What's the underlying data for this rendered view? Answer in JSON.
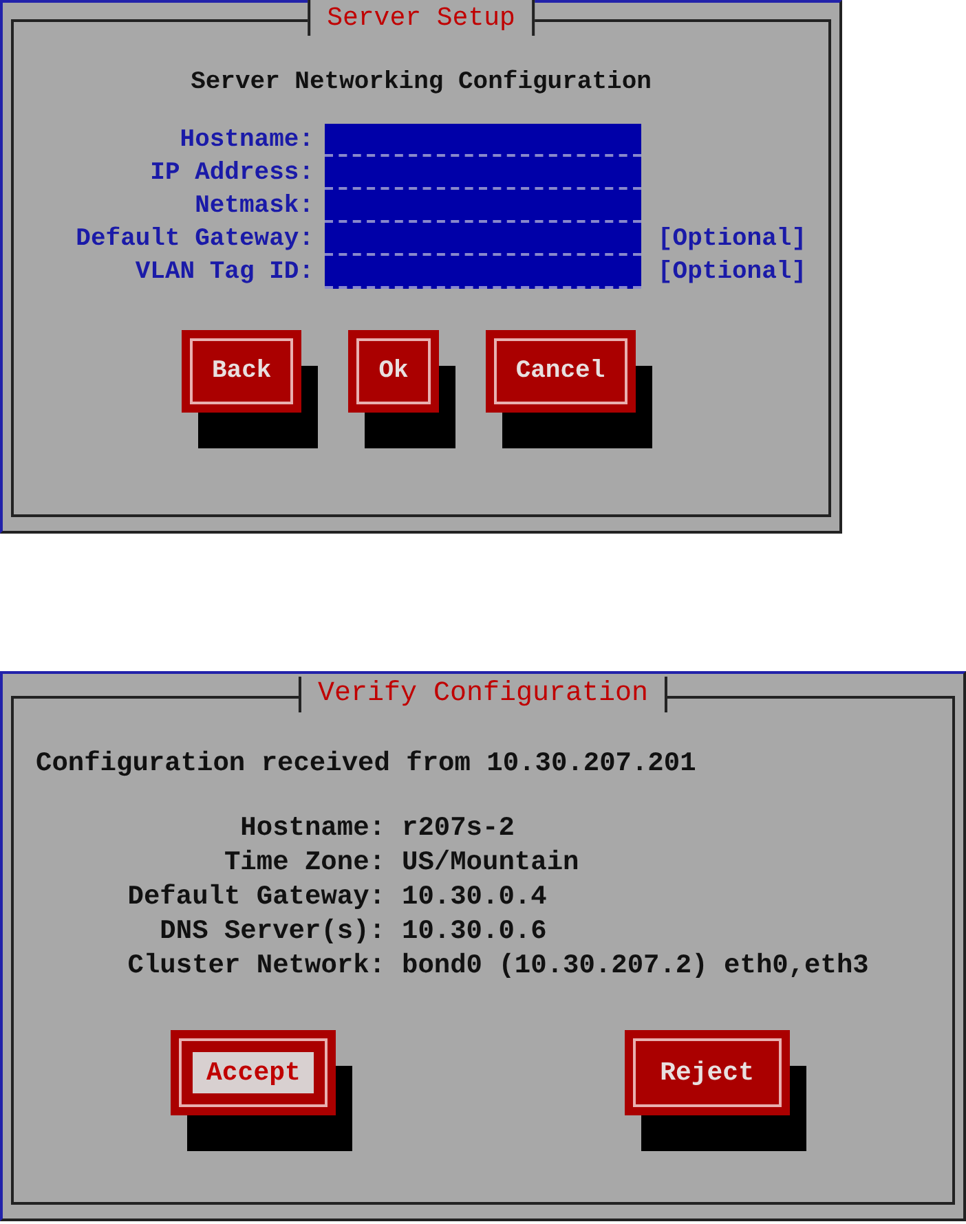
{
  "dialogs": [
    {
      "title": "Server Setup",
      "heading": "Server Networking Configuration",
      "kind": "form",
      "fields": [
        {
          "label": "Hostname:"
        },
        {
          "label": "IP Address:"
        },
        {
          "label": "Netmask:"
        },
        {
          "label": "Default Gateway:",
          "hint": "[Optional]"
        },
        {
          "label": "VLAN Tag ID:",
          "hint": "[Optional]"
        }
      ],
      "buttons": [
        {
          "label": "Back",
          "focused": false
        },
        {
          "label": "Ok",
          "focused": false
        },
        {
          "label": "Cancel",
          "focused": false
        }
      ]
    },
    {
      "title": "Verify Configuration",
      "heading": "Configuration received from 10.30.207.201",
      "kind": "summary",
      "rows": [
        {
          "label": "Hostname:",
          "value": "r207s-2"
        },
        {
          "label": "Time Zone:",
          "value": "US/Mountain"
        },
        {
          "label": "Default Gateway:",
          "value": "10.30.0.4"
        },
        {
          "label": "DNS Server(s):",
          "value": "10.30.0.6"
        },
        {
          "label": "Cluster Network:",
          "value": "bond0 (10.30.207.2) eth0,eth3"
        }
      ],
      "buttons": [
        {
          "label": "Accept",
          "focused": true
        },
        {
          "label": "Reject",
          "focused": false
        }
      ]
    }
  ]
}
